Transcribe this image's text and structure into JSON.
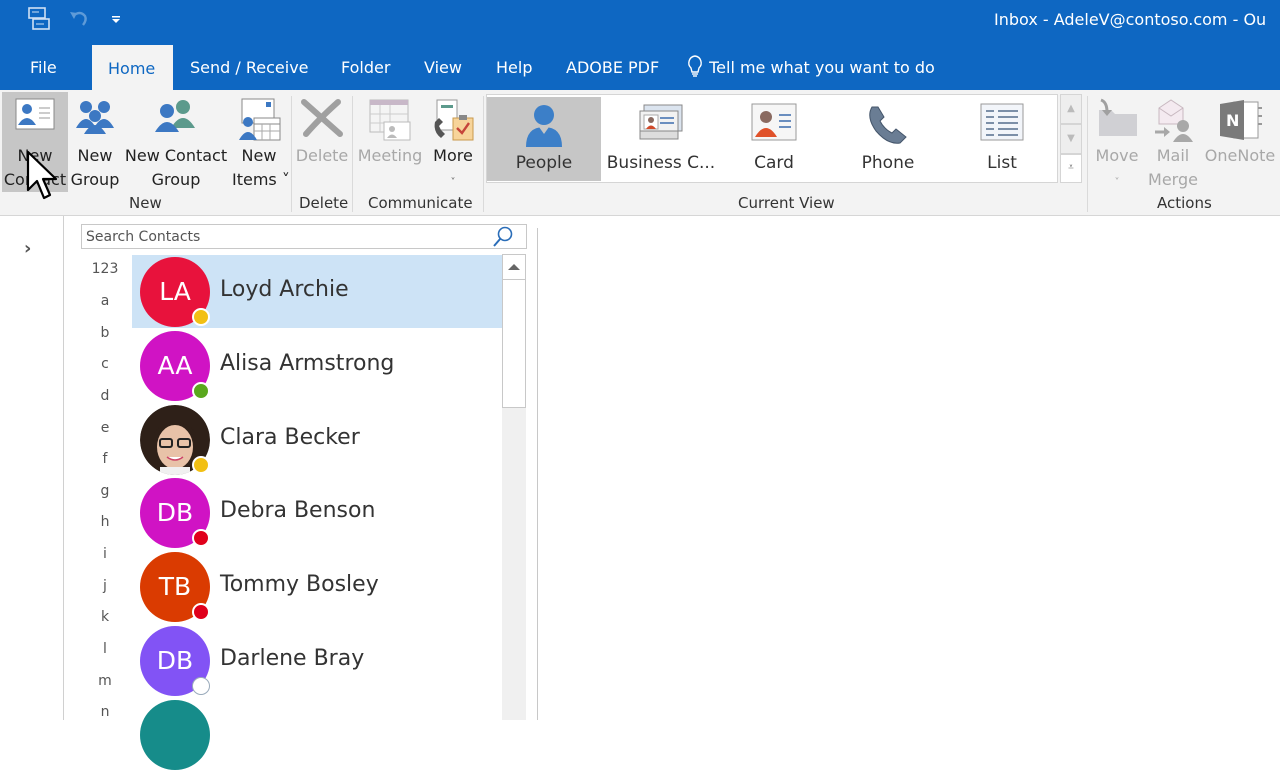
{
  "window": {
    "title": "Inbox - AdeleV@contoso.com  -  Ou",
    "qat": [
      "send-receive-all-icon",
      "undo-icon",
      "customize-qat-icon"
    ]
  },
  "tabs": [
    {
      "label": "File"
    },
    {
      "label": "Home",
      "active": true
    },
    {
      "label": "Send / Receive"
    },
    {
      "label": "Folder"
    },
    {
      "label": "View"
    },
    {
      "label": "Help"
    },
    {
      "label": "ADOBE PDF"
    },
    {
      "label": "Tell me what you want to do"
    }
  ],
  "ribbon": {
    "groups": {
      "new": {
        "label": "New",
        "buttons": [
          {
            "line1": "New",
            "line2": "Contact"
          },
          {
            "line1": "New",
            "line2": "Group"
          },
          {
            "line1": "New Contact",
            "line2": "Group"
          },
          {
            "line1": "New",
            "line2": "Items ˅"
          }
        ]
      },
      "delete": {
        "label": "Delete",
        "buttons": [
          {
            "line1": "Delete",
            "disabled": true
          }
        ]
      },
      "communicate": {
        "label": "Communicate",
        "buttons": [
          {
            "line1": "Meeting",
            "disabled": true
          },
          {
            "line1": "More",
            "line2": "˅"
          }
        ]
      },
      "current_view": {
        "label": "Current View",
        "items": [
          {
            "label": "People",
            "selected": true
          },
          {
            "label": "Business C..."
          },
          {
            "label": "Card"
          },
          {
            "label": "Phone"
          },
          {
            "label": "List"
          }
        ]
      },
      "actions": {
        "label": "Actions",
        "buttons": [
          {
            "line1": "Move",
            "line2": "˅",
            "disabled": true
          },
          {
            "line1": "Mail",
            "line2": "Merge",
            "disabled": true
          },
          {
            "line1": "OneNote",
            "disabled": true
          }
        ]
      }
    }
  },
  "search": {
    "placeholder": "Search Contacts"
  },
  "alpha_index": [
    "123",
    "a",
    "b",
    "c",
    "d",
    "e",
    "f",
    "g",
    "h",
    "i",
    "j",
    "k",
    "l",
    "m",
    "n"
  ],
  "contacts": [
    {
      "initials": "LA",
      "name": "Loyd Archie",
      "color": "#e8123c",
      "presence": "away",
      "selected": true
    },
    {
      "initials": "AA",
      "name": "Alisa Armstrong",
      "color": "#d013c4",
      "presence": "available"
    },
    {
      "initials": "",
      "name": "Clara Becker",
      "color": "#3a2a20",
      "presence": "away",
      "photo": true
    },
    {
      "initials": "DB",
      "name": "Debra Benson",
      "color": "#d013c4",
      "presence": "busy"
    },
    {
      "initials": "TB",
      "name": "Tommy Bosley",
      "color": "#da3b01",
      "presence": "busy"
    },
    {
      "initials": "DB",
      "name": "Darlene Bray",
      "color": "#8253f5",
      "presence": "offline"
    },
    {
      "initials": "",
      "name": "",
      "color": "#168c8a",
      "presence": ""
    }
  ],
  "presence_colors": {
    "away": "#f2c014",
    "available": "#5aa81e",
    "busy": "#e0001b",
    "offline": "#ffffff"
  },
  "colors": {
    "accent": "#0e67c2",
    "selection": "#cde3f6",
    "ribbon_bg": "#f3f3f3"
  }
}
